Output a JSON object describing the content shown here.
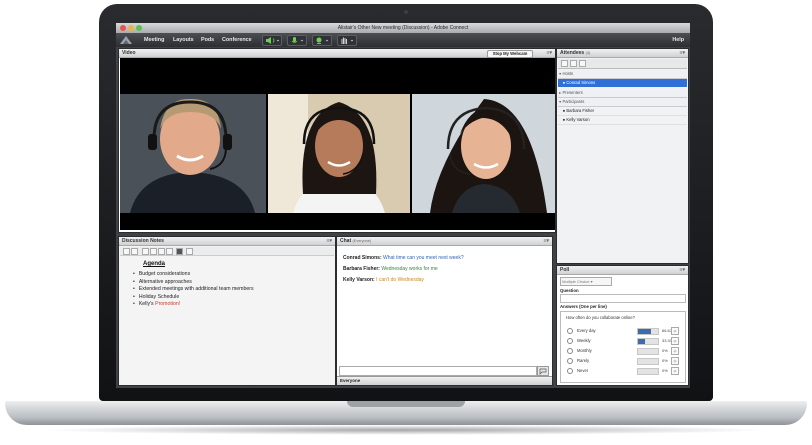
{
  "window": {
    "title": "Alistair's Other New meeting (Discussion) - Adobe Connect"
  },
  "menu": {
    "items": [
      "Meeting",
      "Layouts",
      "Pods",
      "Conference"
    ],
    "help": "Help"
  },
  "video_pod": {
    "title": "Video",
    "webcam_button": "Stop My Webcam"
  },
  "notes_pod": {
    "title": "Discussion Notes",
    "heading": "Agenda",
    "items": [
      "Budget considerations",
      "Alternative approaches",
      "Extended meetings with additional team members",
      "Holiday Schedule",
      "Kelly's"
    ],
    "highlight_word": "Promotion!",
    "highlight_color": "#c0392b"
  },
  "chat_pod": {
    "title": "Chat",
    "subtitle": "(Everyone)",
    "messages": [
      {
        "name": "Conrad Simons:",
        "text": "What time can you meet next week?",
        "color": "#2f63b8"
      },
      {
        "name": "Barbara Fisher:",
        "text": "Wednesday works for me",
        "color": "#2f8a3a"
      },
      {
        "name": "Kelly Varson:",
        "text": "I can't do Wednesday",
        "color": "#c8881f"
      }
    ],
    "tab": "Everyone"
  },
  "attendees_pod": {
    "title": "Attendees",
    "count": "(3)",
    "groups": {
      "hosts": "Hosts",
      "presenters": "Presenters",
      "participants": "Participants"
    },
    "host": "Conrad Simons",
    "participants": [
      "Barbara Fisher",
      "Kelly Varson"
    ]
  },
  "poll_pod": {
    "title": "Poll",
    "type_select": "Multiple Choice",
    "question_label": "Question",
    "answers_label": "Answers (One per line)",
    "question": "How often do you collaborate online?",
    "options": [
      {
        "label": "Every day",
        "pct": "66.67%",
        "value": 0.6667
      },
      {
        "label": "Weekly",
        "pct": "33.33%",
        "value": 0.3333
      },
      {
        "label": "Monthly",
        "pct": "0%",
        "value": 0
      },
      {
        "label": "Rarely",
        "pct": "0%",
        "value": 0
      },
      {
        "label": "Never",
        "pct": "0%",
        "value": 0
      }
    ]
  }
}
